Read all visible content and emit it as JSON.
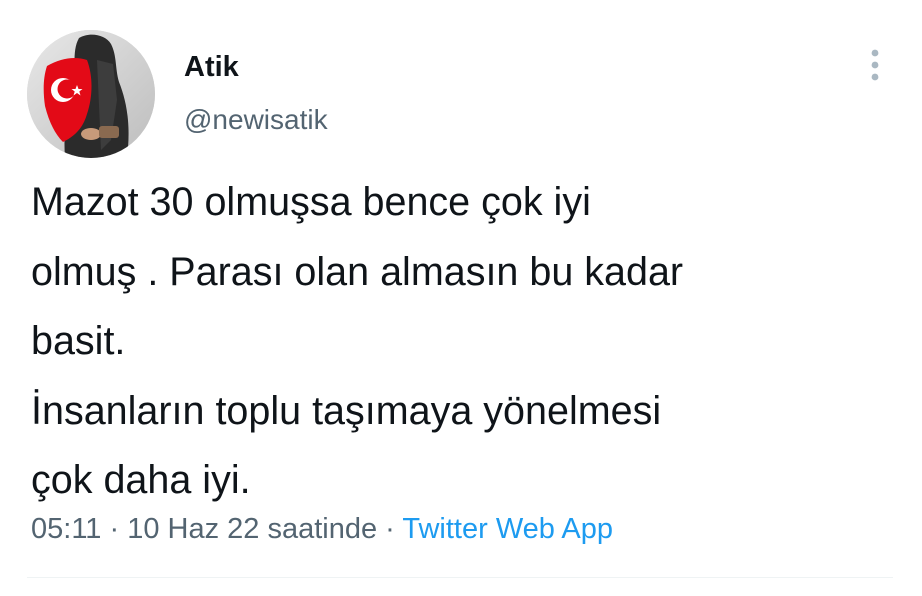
{
  "user": {
    "display_name": "Atik",
    "handle": "@newisatik",
    "avatar_icon": "avatar-photo-flag"
  },
  "menu": {
    "icon": "more-vertical-icon"
  },
  "tweet": {
    "lines": [
      "Mazot 30 olmuşsa bence çok iyi",
      "olmuş . Parası olan almasın bu kadar",
      "basit.",
      "İnsanların toplu taşımaya yönelmesi",
      "çok daha iyi."
    ]
  },
  "meta": {
    "time": "05:11",
    "sep1": " · ",
    "date": "10 Haz 22 saatinde",
    "sep2": " · ",
    "source": "Twitter Web App"
  },
  "colors": {
    "text": "#0f1419",
    "secondary": "#536471",
    "link": "#1d9bf0",
    "flag_red": "#e30a17"
  }
}
